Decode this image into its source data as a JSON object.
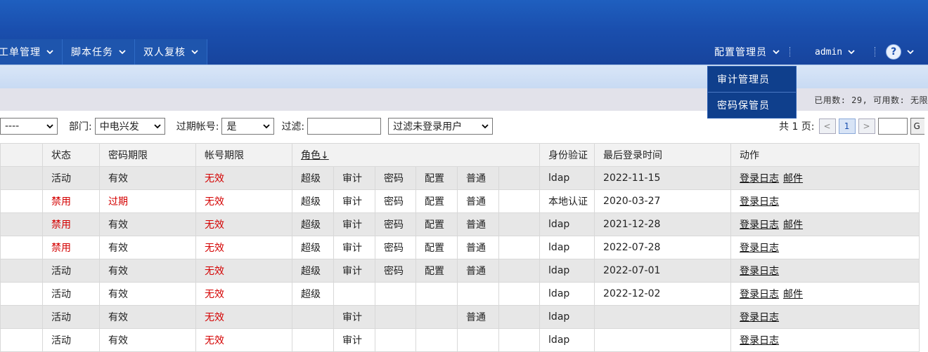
{
  "nav": [
    {
      "label": "工单管理"
    },
    {
      "label": "脚本任务"
    },
    {
      "label": "双人复核"
    }
  ],
  "user": {
    "role": "配置管理员",
    "name": "admin",
    "help": "?"
  },
  "dropdown": [
    "审计管理员",
    "密码保管员"
  ],
  "usage": "已用数: 29, 可用数: 无限",
  "filters": {
    "first_select": "----",
    "dept_label": "部门:",
    "dept_value": "中电兴发",
    "expired_label": "过期帐号:",
    "expired_value": "是",
    "filter_label": "过滤:",
    "filter_value": "",
    "unlogged_value": "过滤未登录用户"
  },
  "pager": {
    "text": "共 1 页:",
    "prev": "<",
    "current": "1",
    "next": ">",
    "go": "G"
  },
  "headers": {
    "status": "状态",
    "pwd_exp": "密码期限",
    "acct_exp": "帐号期限",
    "role": "角色↓",
    "auth": "身份验证",
    "last_login": "最后登录时间",
    "action": "动作"
  },
  "rows": [
    {
      "status": "活动",
      "pwd": "有效",
      "acct": "无效",
      "roles": [
        "超级",
        "审计",
        "密码",
        "配置",
        "普通"
      ],
      "auth": "ldap",
      "last": "2022-11-15",
      "actions": [
        "登录日志",
        "邮件"
      ]
    },
    {
      "status": "禁用",
      "pwd": "过期",
      "acct": "无效",
      "roles": [
        "超级",
        "审计",
        "密码",
        "配置",
        "普通"
      ],
      "auth": "本地认证",
      "last": "2020-03-27",
      "actions": [
        "登录日志"
      ]
    },
    {
      "status": "禁用",
      "pwd": "有效",
      "acct": "无效",
      "roles": [
        "超级",
        "审计",
        "密码",
        "配置",
        "普通"
      ],
      "auth": "ldap",
      "last": "2021-12-28",
      "actions": [
        "登录日志",
        "邮件"
      ]
    },
    {
      "status": "禁用",
      "pwd": "有效",
      "acct": "无效",
      "roles": [
        "超级",
        "审计",
        "密码",
        "配置",
        "普通"
      ],
      "auth": "ldap",
      "last": "2022-07-28",
      "actions": [
        "登录日志"
      ]
    },
    {
      "status": "活动",
      "pwd": "有效",
      "acct": "无效",
      "roles": [
        "超级",
        "审计",
        "密码",
        "配置",
        "普通"
      ],
      "auth": "ldap",
      "last": "2022-07-01",
      "actions": [
        "登录日志"
      ]
    },
    {
      "status": "活动",
      "pwd": "有效",
      "acct": "无效",
      "roles": [
        "超级",
        "",
        "",
        "",
        ""
      ],
      "auth": "ldap",
      "last": "2022-12-02",
      "actions": [
        "登录日志",
        "邮件"
      ]
    },
    {
      "status": "活动",
      "pwd": "有效",
      "acct": "无效",
      "roles": [
        "",
        "审计",
        "",
        "",
        "普通"
      ],
      "auth": "ldap",
      "last": "",
      "actions": [
        "登录日志"
      ]
    },
    {
      "status": "活动",
      "pwd": "有效",
      "acct": "无效",
      "roles": [
        "",
        "审计",
        "",
        "",
        ""
      ],
      "auth": "ldap",
      "last": "",
      "actions": [
        "登录日志"
      ]
    }
  ],
  "colors": {
    "header_blue": "#1a4fae",
    "red": "#d40000",
    "dropdown_bg": "#0f3f8c"
  }
}
